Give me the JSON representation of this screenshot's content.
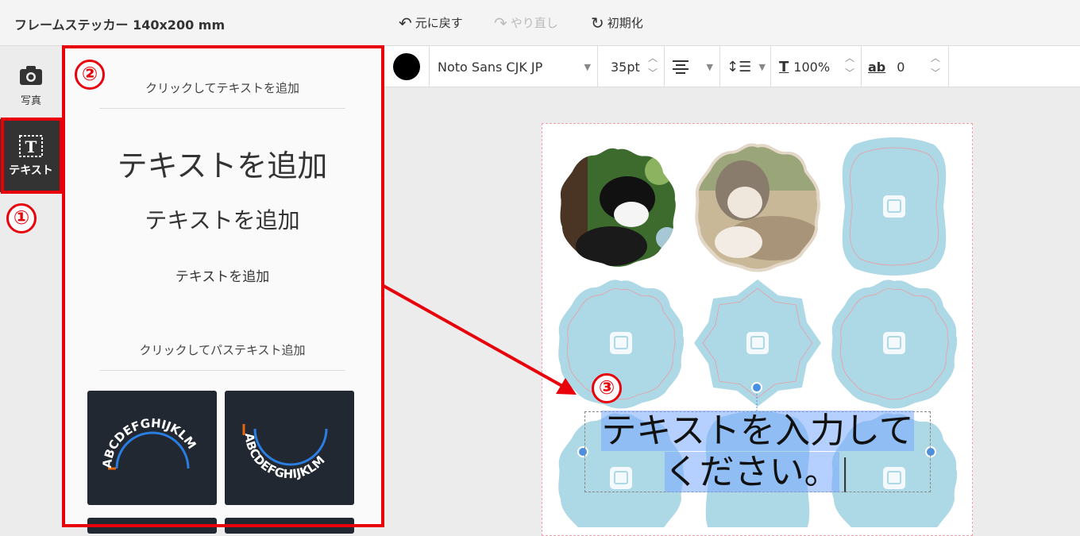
{
  "header": {
    "doc_title": "フレームステッカー 140x200 mm",
    "undo": "元に戻す",
    "redo": "やり直し",
    "reset": "初期化"
  },
  "sidebar": {
    "photo_label": "写真",
    "text_label": "テキスト"
  },
  "panel": {
    "add_text_caption": "クリックしてテキストを追加",
    "sample_large": "テキストを追加",
    "sample_medium": "テキストを追加",
    "sample_small": "テキストを追加",
    "path_text_caption": "クリックしてパステキスト追加",
    "path_sample_text": "ABCDEFGHIJKLM"
  },
  "format_toolbar": {
    "color": "#000000",
    "font_family": "Noto Sans CJK JP",
    "font_size": "35pt",
    "line_scale": "100%",
    "letter_spacing": "0"
  },
  "canvas": {
    "text_content_line1": "テキストを入力して",
    "text_content_line2": "ください。"
  },
  "annotations": {
    "marker1": "①",
    "marker2": "②",
    "marker3": "③",
    "color": "#e8000b"
  },
  "colors": {
    "frame_fill": "#add8e6",
    "frame_line": "#e8a0a8",
    "handle": "#4a90e2"
  }
}
